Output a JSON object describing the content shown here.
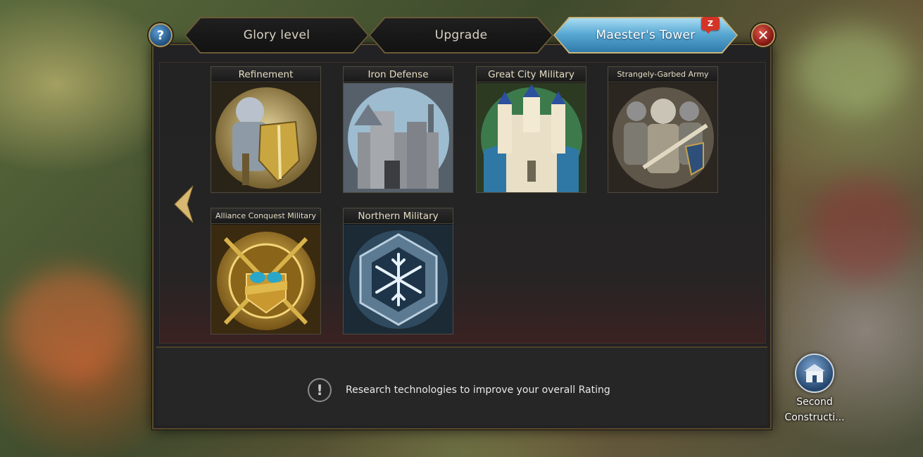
{
  "tabs": [
    {
      "label": "Glory level",
      "active": false
    },
    {
      "label": "Upgrade",
      "active": false
    },
    {
      "label": "Maester's Tower",
      "active": true
    }
  ],
  "badge": {
    "text": "Z"
  },
  "header": {
    "help_icon": "question-icon",
    "close_icon": "close-icon"
  },
  "cards": [
    {
      "title": "Refinement",
      "icon": "armored-knight-icon"
    },
    {
      "title": "Iron Defense",
      "icon": "fortress-wall-icon"
    },
    {
      "title": "Great City Military",
      "icon": "castle-icon"
    },
    {
      "title": "Strangely-Garbed Army",
      "icon": "soldiers-icon"
    },
    {
      "title": "Alliance Conquest Military",
      "icon": "golden-emblem-icon"
    },
    {
      "title": "Northern Military",
      "icon": "snowflake-icon"
    }
  ],
  "footer": {
    "info_text": "Research technologies to improve your overall Rating",
    "icon": "exclamation-icon"
  },
  "side_widget": {
    "label_line1": "Second",
    "label_line2": "Constructi...",
    "icon": "building-icon"
  },
  "colors": {
    "accent_gold": "#c9b57c",
    "active_tab": "#5aa9d4",
    "close_red": "#b8241b"
  }
}
